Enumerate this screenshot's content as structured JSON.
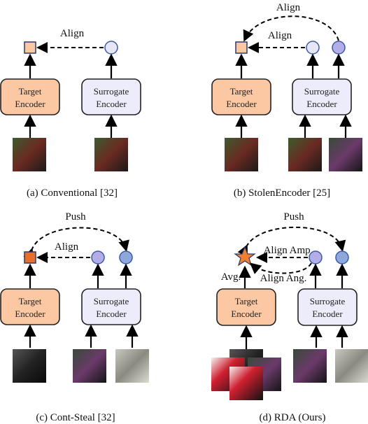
{
  "labels": {
    "align": "Align",
    "push": "Push",
    "align_amp": "Align Amp.",
    "align_ang": "Align Ang.",
    "avg": "Avg."
  },
  "encoders": {
    "target_line1": "Target",
    "target_line2": "Encoder",
    "surrogate_line1": "Surrogate",
    "surrogate_line2": "Encoder"
  },
  "captions": {
    "a": "(a) Conventional [32]",
    "b": "(b) StolenEncoder [25]",
    "c": "(c) Cont-Steal [32]",
    "d": "(d) RDA (Ours)"
  },
  "colors": {
    "target": "#fcc8a4",
    "surrogate": "#ececfa",
    "light_circle": "#e6e6f8",
    "purple_circle": "#b4aee8",
    "blue_circle": "#8ea8dc",
    "star": "#f08030",
    "dark_square": "#e8702a"
  }
}
